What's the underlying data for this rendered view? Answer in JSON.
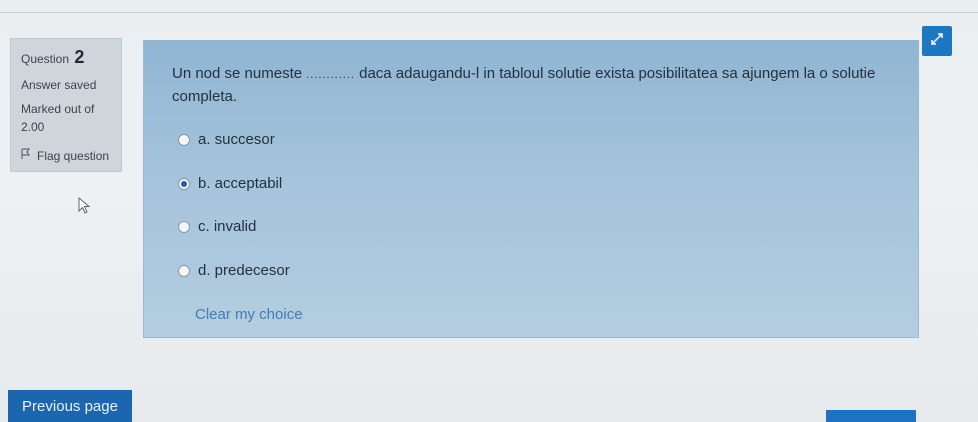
{
  "question_info": {
    "question_label": "Question",
    "question_number": "2",
    "status": "Answer saved",
    "marked_label": "Marked out of",
    "marked_value": "2.00",
    "flag_label": "Flag question"
  },
  "question": {
    "text_before": "Un nod se numeste",
    "blank": "............",
    "text_after": "daca adaugandu-l in tabloul solutie exista posibilitatea sa ajungem la o solutie completa."
  },
  "options": [
    {
      "label": "a. succesor",
      "selected": false
    },
    {
      "label": "b. acceptabil",
      "selected": true
    },
    {
      "label": "c. invalid",
      "selected": false
    },
    {
      "label": "d. predecesor",
      "selected": false
    }
  ],
  "clear_choice": "Clear my choice",
  "navigation": {
    "previous": "Previous page",
    "next": ""
  },
  "colors": {
    "accent": "#1c66b0",
    "panel": "#a3c2da"
  },
  "icons": {
    "expand": "expand-icon",
    "flag": "flag-icon",
    "cursor": "mouse-pointer-icon"
  }
}
